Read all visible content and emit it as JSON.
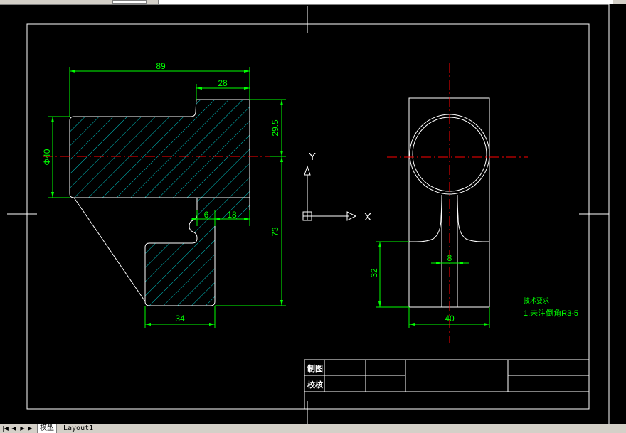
{
  "dimensions": {
    "top_width": "89",
    "top_small": "28",
    "right_upper": "29.5",
    "diameter": "Φ40",
    "right_lower": "73",
    "neck": "6",
    "step": "18",
    "bottom": "34",
    "side_height": "32",
    "side_width": "40",
    "side_neck": "8"
  },
  "ucs": {
    "y_label": "Y",
    "x_label": "X"
  },
  "notes": {
    "title": "技术要求",
    "line1": "1.未注倒角R3-5"
  },
  "title_block": {
    "drawn_label": "制图",
    "checked_label": "校核"
  },
  "tabs": {
    "model": "模型",
    "layout": "Layout1"
  },
  "nav": {
    "first": "|◀",
    "prev": "◀",
    "next": "▶",
    "last": "▶|"
  },
  "colors": {
    "background": "#000000",
    "lines": "#ffffff",
    "dimensions": "#00ff00",
    "hatch": "#00cccc",
    "centerline": "#ff0000"
  }
}
